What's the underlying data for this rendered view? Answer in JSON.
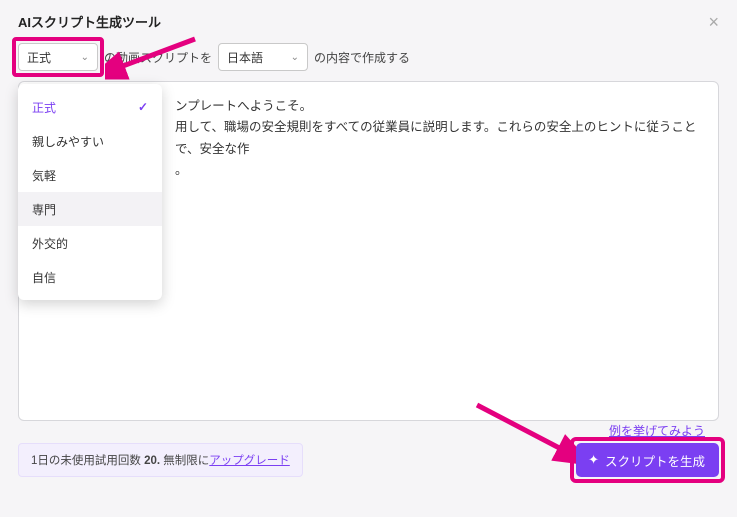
{
  "header": {
    "title": "AIスクリプト生成ツール",
    "close_label": "×"
  },
  "controls": {
    "tone_selected": "正式",
    "mid_text": "の動画スクリプトを",
    "lang_selected": "日本語",
    "tail_text": "の内容で作成する"
  },
  "tone_options": [
    {
      "label": "正式",
      "selected": true
    },
    {
      "label": "親しみやすい",
      "selected": false
    },
    {
      "label": "気軽",
      "selected": false
    },
    {
      "label": "専門",
      "selected": false,
      "hover": true
    },
    {
      "label": "外交的",
      "selected": false
    },
    {
      "label": "自信",
      "selected": false
    }
  ],
  "body": {
    "line1_suffix": "ンプレートへようこそ。",
    "line2_suffix": "用して、職場の安全規則をすべての従業員に説明します。これらの安全上のヒントに従うことで、安全な作",
    "line3_suffix": "。"
  },
  "links": {
    "example": "例を挙げてみよう"
  },
  "footer": {
    "trial_prefix": "1日の未使用試用回数 ",
    "trial_count": "20.",
    "trial_mid": " 無制限に",
    "upgrade": "アップグレード",
    "generate_label": "スクリプトを生成"
  }
}
